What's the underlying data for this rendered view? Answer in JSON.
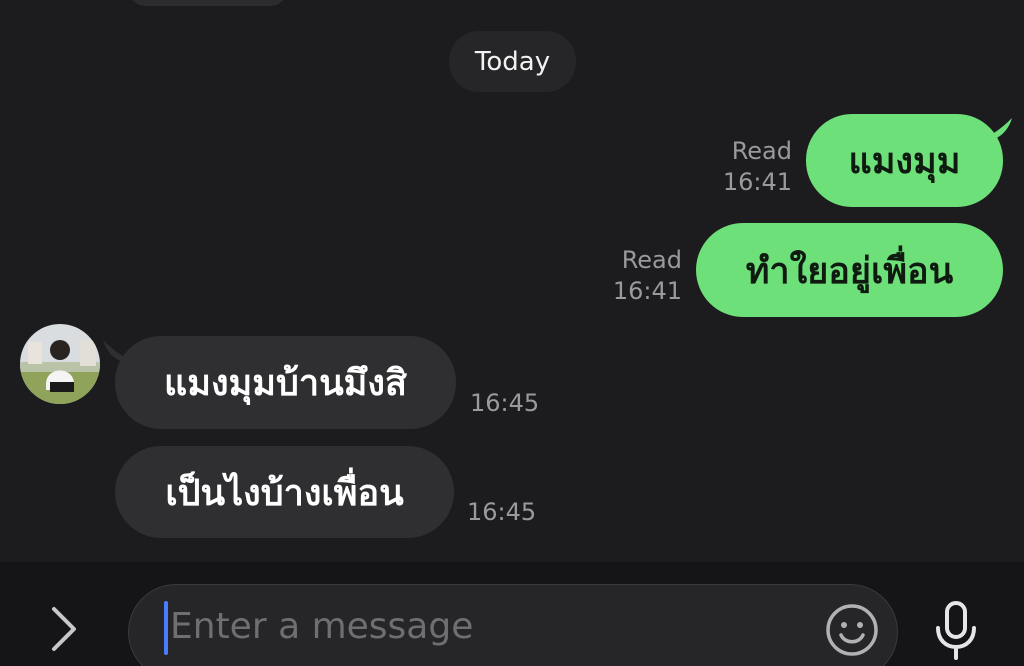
{
  "date_separator": "Today",
  "messages": [
    {
      "direction": "outgoing",
      "text": "แมงมุม",
      "status": "Read",
      "time": "16:41"
    },
    {
      "direction": "outgoing",
      "text": "ทำใยอยู่เพื่อน",
      "status": "Read",
      "time": "16:41"
    },
    {
      "direction": "incoming",
      "text": "แมงมุมบ้านมึงสิ",
      "time": "16:45"
    },
    {
      "direction": "incoming",
      "text": "เป็นไงบ้างเพื่อน",
      "time": "16:45"
    }
  ],
  "composer": {
    "placeholder": "Enter a message",
    "icons": [
      "chevron-right-icon",
      "emoji-icon",
      "microphone-icon"
    ]
  },
  "colors": {
    "background": "#1c1c1e",
    "outgoing_bubble": "#6ee07a",
    "incoming_bubble": "#2f2f31",
    "cursor": "#4a7cff"
  }
}
